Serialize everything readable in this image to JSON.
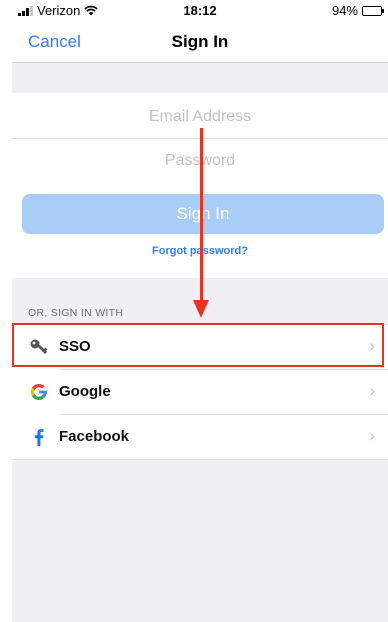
{
  "status_bar": {
    "carrier": "Verizon",
    "time": "18:12",
    "battery": "94%",
    "battery_level": 0.94
  },
  "nav": {
    "cancel": "Cancel",
    "title": "Sign In"
  },
  "form": {
    "email_placeholder": "Email Address",
    "password_placeholder": "Password",
    "signin_label": "Sign In",
    "forgot_label": "Forgot password?"
  },
  "alt_signin": {
    "header": "OR, SIGN IN WITH",
    "options": [
      {
        "label": "SSO",
        "icon": "key-icon"
      },
      {
        "label": "Google",
        "icon": "google-icon"
      },
      {
        "label": "Facebook",
        "icon": "facebook-icon"
      }
    ]
  },
  "annotation": {
    "color": "#e8331f"
  },
  "colors": {
    "accent": "#2f7ef6",
    "button_disabled": "#a9cdf6",
    "facebook": "#1877f2"
  }
}
